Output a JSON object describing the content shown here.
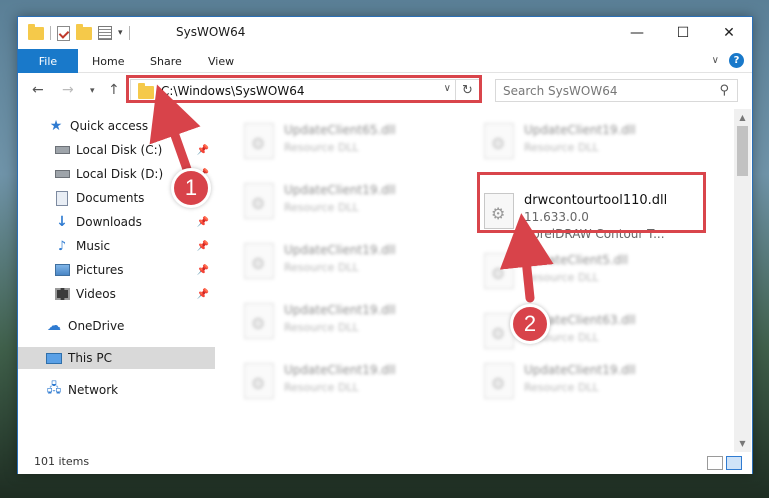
{
  "window": {
    "title": "SysWOW64",
    "controls": {
      "minimize": "—",
      "maximize": "☐",
      "close": "✕"
    }
  },
  "ribbon": {
    "tabs": [
      "File",
      "Home",
      "Share",
      "View"
    ],
    "help": "?"
  },
  "navigation": {
    "address_path": "C:\\Windows\\SysWOW64",
    "search_placeholder": "Search SysWOW64"
  },
  "sidebar": {
    "items": [
      {
        "label": "Quick access",
        "icon": "star-icon"
      },
      {
        "label": "Local Disk (C:)",
        "icon": "drive-icon",
        "pinned": true
      },
      {
        "label": "Local Disk (D:)",
        "icon": "drive-icon",
        "pinned": true
      },
      {
        "label": "Documents",
        "icon": "documents-icon",
        "pinned": true
      },
      {
        "label": "Downloads",
        "icon": "downloads-icon",
        "pinned": true
      },
      {
        "label": "Music",
        "icon": "music-icon",
        "pinned": true
      },
      {
        "label": "Pictures",
        "icon": "pictures-icon",
        "pinned": true
      },
      {
        "label": "Videos",
        "icon": "videos-icon",
        "pinned": true
      },
      {
        "label": "OneDrive",
        "icon": "onedrive-icon"
      },
      {
        "label": "This PC",
        "icon": "this-pc-icon",
        "selected": true
      },
      {
        "label": "Network",
        "icon": "network-icon"
      }
    ]
  },
  "files": {
    "left_column": [
      {
        "name": "UpdateClient65.dll",
        "type": "Resource DLL"
      },
      {
        "name": "UpdateClient19.dll",
        "type": "Resource DLL"
      },
      {
        "name": "UpdateClient19.dll",
        "type": "Resource DLL"
      },
      {
        "name": "UpdateClient19.dll",
        "type": "Resource DLL"
      },
      {
        "name": "UpdateClient19.dll",
        "type": "Resource DLL"
      }
    ],
    "right_column": [
      {
        "name": "UpdateClient19.dll",
        "type": "Resource DLL"
      },
      {
        "name": "UpdateClient5.dll",
        "type": "Resource DLL"
      },
      {
        "name": "UpdateClient63.dll",
        "type": "Resource DLL"
      },
      {
        "name": "UpdateClient19.dll",
        "type": "Resource DLL"
      }
    ],
    "highlighted": {
      "name": "drwcontourtool110.dll",
      "version": "11.633.0.0",
      "description": "CorelDRAW Contour T..."
    }
  },
  "status": {
    "item_count": "101 items"
  },
  "callouts": [
    "1",
    "2"
  ],
  "colors": {
    "accent": "#1979ca",
    "highlight": "#d9454b",
    "selected": "#d9d9d9"
  }
}
